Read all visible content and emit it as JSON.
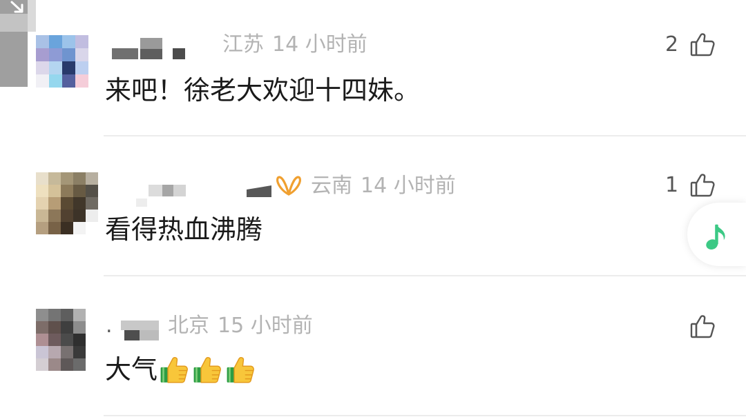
{
  "comments": [
    {
      "location": "江苏",
      "time": "14 小时前",
      "likes": "2",
      "text": "来吧！徐老大欢迎十四妹。",
      "avatar_mosaic": [
        [
          "#a9c1e6",
          "#6aa4dc",
          "#9cc3ea",
          "#c1bde0"
        ],
        [
          "#a79dd0",
          "#8e9bd5",
          "#6f94cf",
          "#d9d6ea"
        ],
        [
          "#dcd7ea",
          "#b4d5f0",
          "#283a6b",
          "#bccff0"
        ],
        [
          "#f1f0f5",
          "#95d7ee",
          "#54609e",
          "#f5cdd9"
        ]
      ]
    },
    {
      "badge_icon": "channels-butterfly-icon",
      "location": "云南",
      "time": "14 小时前",
      "likes": "1",
      "text": "看得热血沸腾",
      "avatar_mosaic": [
        [
          "#e8dfcb",
          "#c6b99a",
          "#a49677",
          "#8b7f65",
          "#b7afa0"
        ],
        [
          "#eee0bf",
          "#d4c199",
          "#8c7a5a",
          "#675a43",
          "#545048"
        ],
        [
          "#e4d2b0",
          "#b79d76",
          "#5a4a33",
          "#41372a",
          "#6f6a62"
        ],
        [
          "#c9b795",
          "#8c7759",
          "#514130",
          "#3d3328",
          "#ededed"
        ],
        [
          "#b59f80",
          "#786247",
          "#3b2f23",
          "#f3f3f3",
          "#ffffff"
        ]
      ]
    },
    {
      "name_fragment": ".",
      "location": "北京",
      "time": "15 小时前",
      "text": "大气",
      "emojis": [
        "thumbs-up-emoji",
        "thumbs-up-emoji",
        "thumbs-up-emoji"
      ],
      "avatar_mosaic": [
        [
          "#8e8e8e",
          "#747474",
          "#5e5e5e",
          "#b1b1b1"
        ],
        [
          "#7d6d69",
          "#5f504c",
          "#3f3f3f",
          "#8d8d8d"
        ],
        [
          "#ae8f93",
          "#6e5b5d",
          "#4b4b4b",
          "#2f2f2f"
        ],
        [
          "#cac5d5",
          "#b7a8af",
          "#787171",
          "#3a3a3a"
        ],
        [
          "#d4ced3",
          "#9b8989",
          "#5e5858",
          "#6b6b6b"
        ]
      ]
    }
  ],
  "like_icon": "thumbs-up-outline-icon",
  "floating_button": {
    "icon": "music-note-icon"
  },
  "colors": {
    "text": "#1a1a1a",
    "meta": "#b3b3b3",
    "like": "#555555",
    "music_note": "#3cc985",
    "channels_badge": "#f0a030",
    "divider": "#ececec"
  }
}
